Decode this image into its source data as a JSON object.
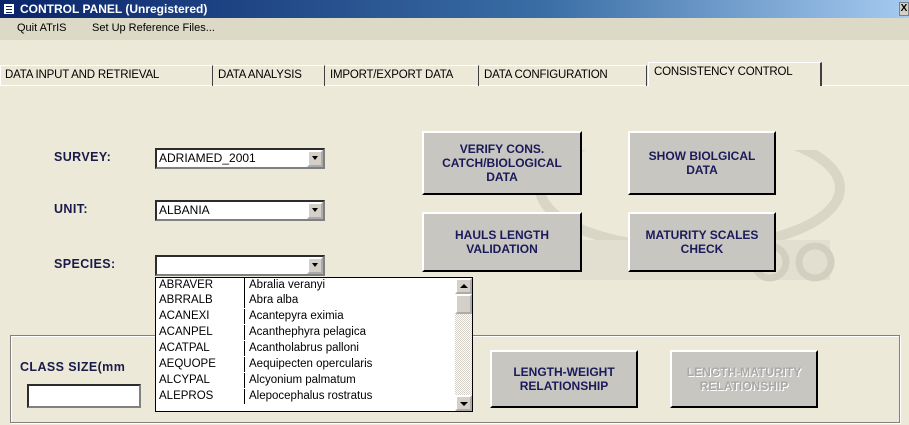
{
  "window": {
    "title": "CONTROL PANEL (Unregistered)",
    "close_glyph": "X"
  },
  "menu": {
    "items": [
      "Quit ATrIS",
      "Set Up Reference Files..."
    ]
  },
  "tabs": [
    {
      "label": "DATA INPUT AND RETRIEVAL",
      "active": false
    },
    {
      "label": "DATA ANALYSIS",
      "active": false
    },
    {
      "label": "IMPORT/EXPORT DATA",
      "active": false
    },
    {
      "label": "DATA CONFIGURATION",
      "active": false
    },
    {
      "label": "CONSISTENCY CONTROL",
      "active": true
    }
  ],
  "form": {
    "survey_label": "SURVEY:",
    "survey_value": "ADRIAMED_2001",
    "unit_label": "UNIT:",
    "unit_value": "ALBANIA",
    "species_label": "SPECIES:",
    "species_value": "",
    "class_size_label": "CLASS SIZE(mm",
    "class_size_value": ""
  },
  "buttons": {
    "verify": "VERIFY CONS. CATCH/BIOLOGICAL DATA",
    "show_bio": "SHOW BIOLGICAL DATA",
    "hauls": "HAULS LENGTH VALIDATION",
    "maturity": "MATURITY SCALES CHECK",
    "length_weight": "LENGTH-WEIGHT RELATIONSHIP",
    "length_maturity": "LENGTH-MATURITY RELATIONSHIP"
  },
  "species_list": [
    {
      "code": "ABRAVER",
      "name": "Abralia veranyi"
    },
    {
      "code": "ABRRALB",
      "name": "Abra alba"
    },
    {
      "code": "ACANEXI",
      "name": "Acantepyra eximia"
    },
    {
      "code": "ACANPEL",
      "name": "Acanthephyra pelagica"
    },
    {
      "code": "ACATPAL",
      "name": "Acantholabrus palloni"
    },
    {
      "code": "AEQUOPE",
      "name": "Aequipecten opercularis"
    },
    {
      "code": "ALCYPAL",
      "name": "Alcyonium palmatum"
    },
    {
      "code": "ALEPROS",
      "name": "Alepocephalus rostratus"
    }
  ],
  "colors": {
    "titlebar": "#0a246a",
    "face": "#ece9d8",
    "button_text": "#1a1a5a"
  }
}
